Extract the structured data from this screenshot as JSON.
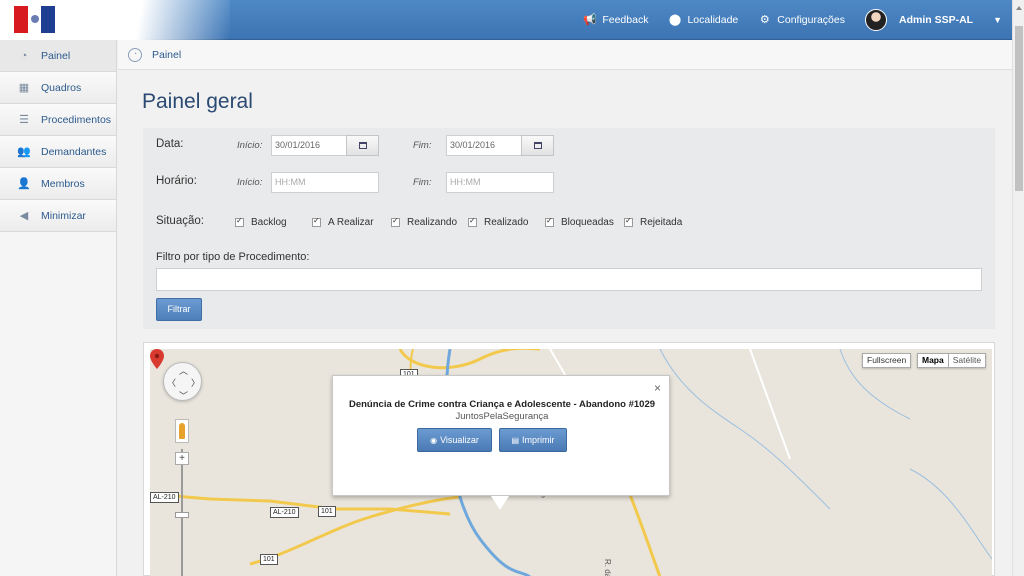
{
  "topbar": {
    "nav": [
      {
        "label": "Feedback",
        "icon": "megaphone-icon"
      },
      {
        "label": "Localidade",
        "icon": "map-pin-icon"
      },
      {
        "label": "Configurações",
        "icon": "gear-icon"
      }
    ],
    "user": {
      "name": "Admin SSP-AL"
    }
  },
  "sidebar": {
    "items": [
      {
        "label": "Painel",
        "icon": "dashboard-icon"
      },
      {
        "label": "Quadros",
        "icon": "board-icon"
      },
      {
        "label": "Procedimentos",
        "icon": "stack-icon"
      },
      {
        "label": "Demandantes",
        "icon": "people-icon"
      },
      {
        "label": "Membros",
        "icon": "members-icon"
      },
      {
        "label": "Minimizar",
        "icon": "collapse-icon"
      }
    ]
  },
  "breadcrumb": {
    "label": "Painel"
  },
  "page": {
    "title": "Painel geral"
  },
  "filters": {
    "date_label": "Data:",
    "time_label": "Horário:",
    "start_label": "Início:",
    "end_label": "Fim:",
    "date_start": "30/01/2016",
    "date_end": "30/01/2016",
    "time_placeholder": "HH:MM",
    "status_label": "Situação:",
    "statuses": [
      {
        "label": "Backlog",
        "checked": true
      },
      {
        "label": "A Realizar",
        "checked": true
      },
      {
        "label": "Realizando",
        "checked": true
      },
      {
        "label": "Realizado",
        "checked": true
      },
      {
        "label": "Bloqueadas",
        "checked": true
      },
      {
        "label": "Rejeitada",
        "checked": true
      }
    ],
    "procedure_label": "Filtro por tipo de Procedimento:",
    "procedure_value": "",
    "filter_button": "Filtrar"
  },
  "map": {
    "fullscreen_label": "Fullscreen",
    "type_options": [
      "Mapa",
      "Satélite"
    ],
    "selected_type": "Mapa",
    "road_labels": [
      "101",
      "AL-210",
      "AL-210",
      "101",
      "101"
    ],
    "place_labels": [
      "Rio Largo",
      "R. das Cas"
    ],
    "popup": {
      "title": "Denúncia de Crime contra Criança e Adolescente - Abandono #1029",
      "subtitle": "JuntosPelaSegurança",
      "view_button": "Visualizar",
      "print_button": "Imprimir"
    }
  },
  "colors": {
    "topbar": "#4a82c0",
    "accent": "#2c5a8c",
    "button": "#5a8bc4",
    "marker": "#d93a30"
  }
}
